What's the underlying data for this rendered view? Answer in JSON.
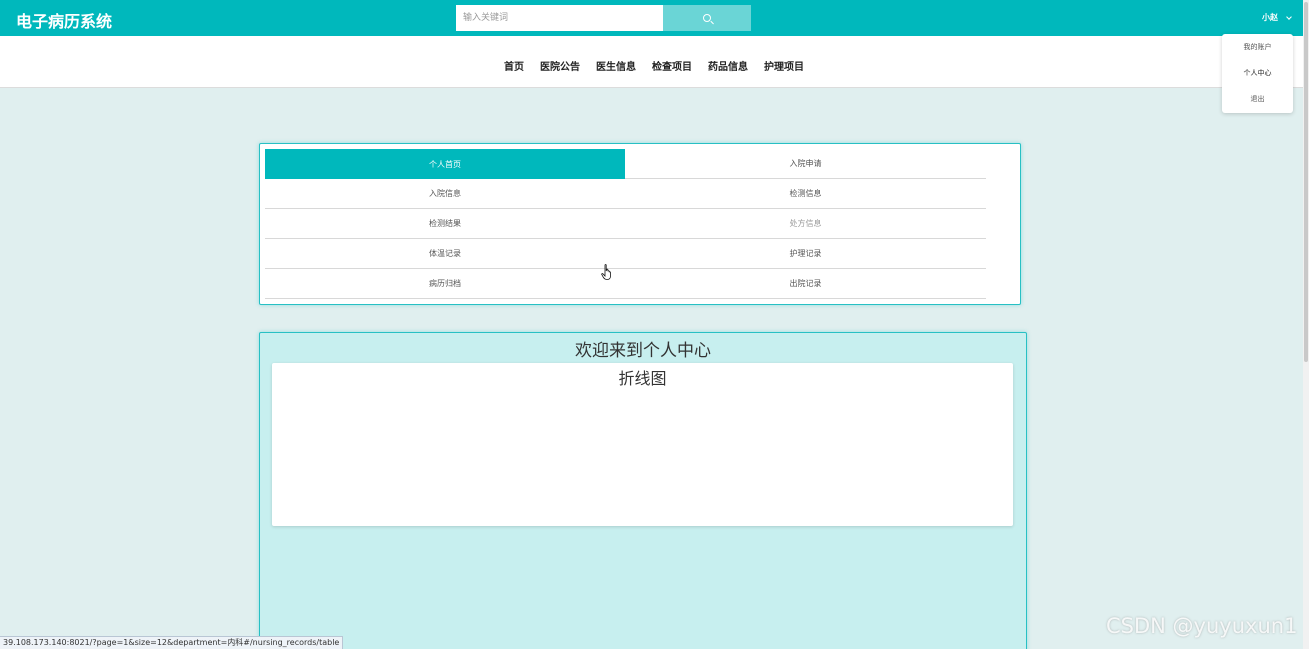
{
  "header": {
    "app_title": "电子病历系统",
    "search_placeholder": "输入关键词",
    "user_name": "小赵"
  },
  "user_dropdown": {
    "items": [
      {
        "label": "我的账户"
      },
      {
        "label": "个人中心"
      },
      {
        "label": "退出"
      }
    ]
  },
  "nav": {
    "items": [
      {
        "label": "首页"
      },
      {
        "label": "医院公告"
      },
      {
        "label": "医生信息"
      },
      {
        "label": "检查项目"
      },
      {
        "label": "药品信息"
      },
      {
        "label": "护理项目"
      }
    ]
  },
  "menu": {
    "items": [
      {
        "label": "个人首页"
      },
      {
        "label": "入院申请"
      },
      {
        "label": "入院信息"
      },
      {
        "label": "检测信息"
      },
      {
        "label": "检测结果"
      },
      {
        "label": "处方信息"
      },
      {
        "label": "体温记录"
      },
      {
        "label": "护理记录"
      },
      {
        "label": "病历归档"
      },
      {
        "label": "出院记录"
      }
    ]
  },
  "main": {
    "welcome": "欢迎来到个人中心",
    "chart_title": "折线图"
  },
  "status_bar": {
    "url": "39.108.173.140:8021/?page=1&size=12&department=内科#/nursing_records/table"
  },
  "watermark": "CSDN @yuyuxun1",
  "colors": {
    "accent": "#00b8bc",
    "page_bg": "#e0efef",
    "panel_bg": "#c7efef"
  }
}
